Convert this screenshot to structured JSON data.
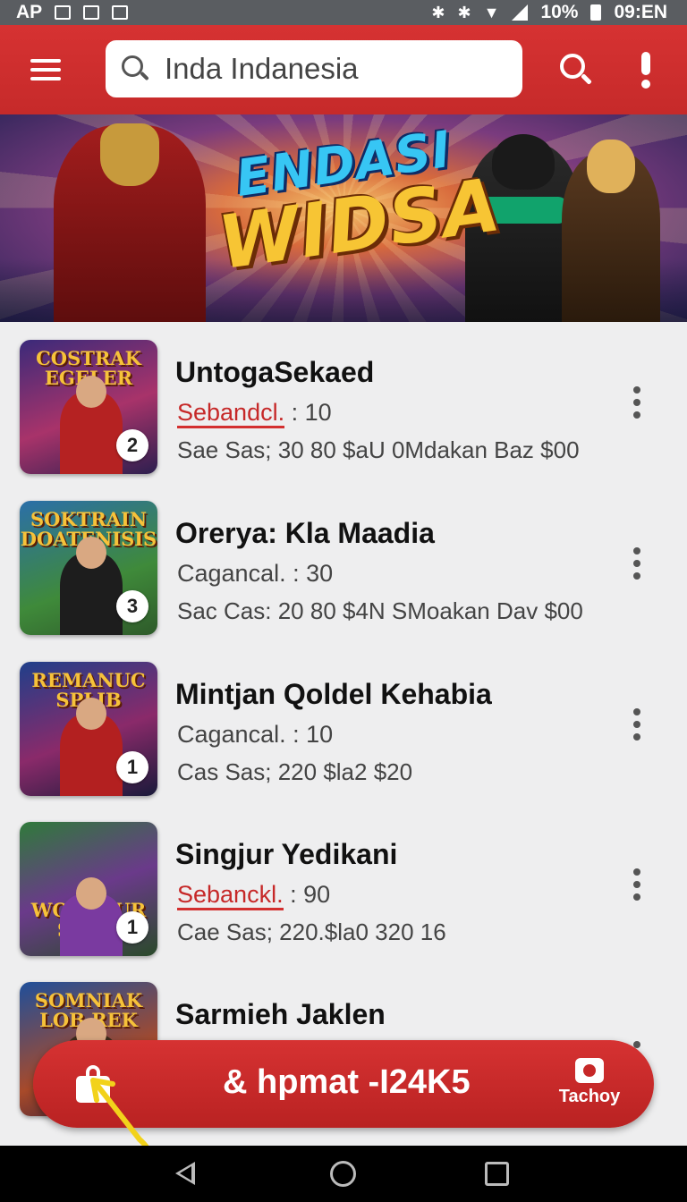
{
  "status_bar": {
    "left_text": "AP",
    "battery": "10%",
    "time": "09:EN"
  },
  "header": {
    "search_value": "Inda Indanesia",
    "icons": [
      "menu-icon",
      "search-icon",
      "alert-icon"
    ]
  },
  "banner": {
    "title_line1": "ENDASI",
    "title_line2": "WIDSA"
  },
  "list": {
    "items": [
      {
        "title": "UntogaSekaed",
        "sub_label": "Sebandcl.",
        "sub_value": " :  10",
        "meta": "Sae Sas;  30  80  $aU  0Mdakan Baz  $00",
        "thumb_title": "COSTRAK EGELER",
        "badge": "2",
        "highlighted_label": true
      },
      {
        "title": "Orerya: Kla Maadia",
        "sub_label": "Cagancal.",
        "sub_value": " :  30",
        "meta": "Sac Cas:  20  80  $4N  SMoakan Dav  $00",
        "thumb_title": "SOKTRAIN DOATENISIS",
        "badge": "3",
        "highlighted_label": false
      },
      {
        "title": "Mintjan Qoldel Kehabia",
        "sub_label": "Cagancal.",
        "sub_value": " :  10",
        "meta": "Cas Sas;  220  $la2  $20",
        "thumb_title": "REMANUC SPLIB",
        "badge": "1",
        "highlighted_label": false
      },
      {
        "title": "Singjur Yedikani",
        "sub_label": "Sebanckl.",
        "sub_value": " :  90",
        "meta": "Cae Sas;  220.$la0  320 16",
        "thumb_title": "WOENTUR SOCH",
        "badge": "1",
        "highlighted_label": true
      },
      {
        "title": "Sarmieh Jaklen",
        "sub_label": "",
        "sub_value": "",
        "meta": "",
        "thumb_title": "SOMNIAK LOB REK",
        "badge": "",
        "highlighted_label": false
      }
    ]
  },
  "action_bar": {
    "text": "& hpmat -I24K5",
    "right_label": "Tachoy",
    "icons": [
      "bag-icon",
      "camera-icon"
    ]
  },
  "colors": {
    "header_red": "#d32f2f",
    "annotation_yellow": "#f2d21b"
  }
}
